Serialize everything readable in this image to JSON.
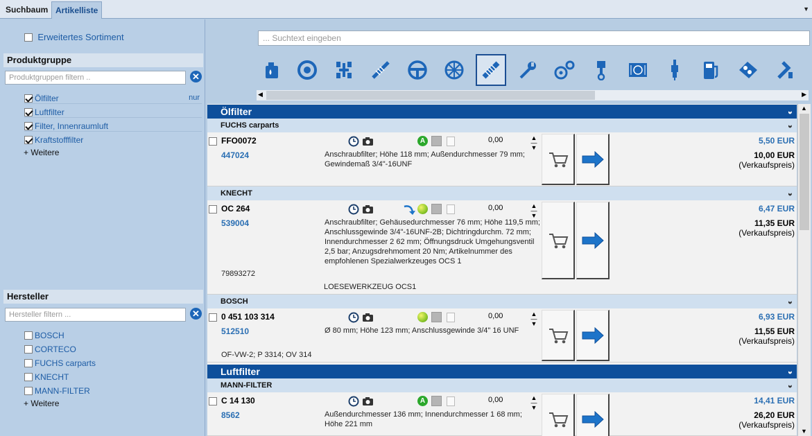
{
  "tabs": [
    {
      "label": "Suchbaum"
    },
    {
      "label": "Artikelliste"
    }
  ],
  "sidebar": {
    "extended_label": "Erweitertes Sortiment",
    "produktgruppe": {
      "title": "Produktgruppe",
      "placeholder": "Produktgruppen filtern ..",
      "items": [
        {
          "label": "Ölfilter",
          "checked": true,
          "extra": "nur"
        },
        {
          "label": "Luftfilter",
          "checked": true
        },
        {
          "label": "Filter, Innenraumluft",
          "checked": true
        },
        {
          "label": "Kraftstofffilter",
          "checked": true
        }
      ],
      "more": "+ Weitere"
    },
    "hersteller": {
      "title": "Hersteller",
      "placeholder": "Hersteller filtern ...",
      "items": [
        {
          "label": "BOSCH",
          "checked": false
        },
        {
          "label": "CORTECO",
          "checked": false
        },
        {
          "label": "FUCHS carparts",
          "checked": false
        },
        {
          "label": "KNECHT",
          "checked": false
        },
        {
          "label": "MANN-FILTER",
          "checked": false
        }
      ],
      "more": "+ Weitere"
    }
  },
  "search": {
    "placeholder": "... Suchtext eingeben"
  },
  "categories": [
    "oil-can-icon",
    "brake-disc-icon",
    "axle-icon",
    "shock-absorber-icon",
    "steering-wheel-icon",
    "wheel-icon",
    "filter-icon",
    "wrench-icon",
    "belt-drive-icon",
    "piston-icon",
    "radiator-icon",
    "spark-plug-icon",
    "fuel-pump-icon",
    "gasket-icon",
    "exhaust-icon"
  ],
  "selected_category": "filter-icon",
  "list": {
    "groups": [
      {
        "title": "Ölfilter"
      },
      {
        "title": "Luftfilter"
      }
    ],
    "manufacturers": [
      {
        "name": "FUCHS carparts"
      },
      {
        "name": "KNECHT"
      },
      {
        "name": "BOSCH"
      },
      {
        "name": "MANN-FILTER"
      }
    ],
    "articles": [
      {
        "number": "FFO0072",
        "id": "447024",
        "qty": "0,00",
        "desc": "Anschraubfilter; Höhe 118 mm; Außendurchmesser 79 mm; Gewindemaß 3/4\"-16UNF",
        "price_buy": "5,50 EUR",
        "price_sell": "10,00 EUR",
        "price_note": "(Verkaufspreis)",
        "status": "A"
      },
      {
        "number": "OC 264",
        "id": "539004",
        "qty": "0,00",
        "desc": "Anschraubfilter; Gehäusedurchmesser 76 mm; Höhe 119,5 mm; Anschlussgewinde 3/4\"-16UNF-2B; Dichtringdurchm. 72 mm; Innendurchmesser 2 62 mm; Öffnungsdruck Umgehungsventil 2,5 bar; Anzugsdrehmoment 20 Nm; Artikelnummer des empfohlenen Spezialwerkzeuges OCS 1",
        "ref": "79893272",
        "note": "LOESEWERKZEUG OCS1",
        "price_buy": "6,47 EUR",
        "price_sell": "11,35 EUR",
        "price_note": "(Verkaufspreis)"
      },
      {
        "number": "0 451 103 314",
        "id": "512510",
        "qty": "0,00",
        "desc": "Ø 80 mm; Höhe 123 mm; Anschlussgewinde 3/4\" 16 UNF",
        "ref": "OF-VW-2; P 3314; OV 314",
        "price_buy": "6,93 EUR",
        "price_sell": "11,55 EUR",
        "price_note": "(Verkaufspreis)"
      },
      {
        "number": "C 14 130",
        "id": "8562",
        "qty": "0,00",
        "desc": "Außendurchmesser 136 mm; Innendurchmesser 1 68 mm; Höhe 221 mm",
        "price_buy": "14,41 EUR",
        "price_sell": "26,20 EUR",
        "price_note": "(Verkaufspreis)",
        "status": "A"
      }
    ]
  },
  "colors": {
    "accent": "#0e4f9b",
    "link": "#2b6fb3",
    "sidebar_bg": "#b9cfe6"
  }
}
